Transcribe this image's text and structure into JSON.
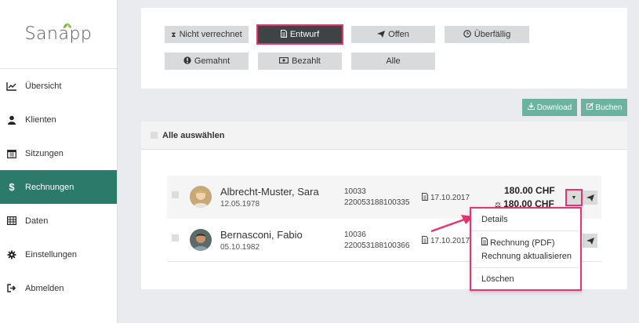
{
  "app": {
    "logo": "Sanapp"
  },
  "sidebar": {
    "items": [
      {
        "label": "Übersicht",
        "icon": "line-chart-icon"
      },
      {
        "label": "Klienten",
        "icon": "user-icon"
      },
      {
        "label": "Sitzungen",
        "icon": "calendar-icon"
      },
      {
        "label": "Rechnungen",
        "icon": "dollar-icon",
        "active": true
      },
      {
        "label": "Daten",
        "icon": "table-icon"
      },
      {
        "label": "Einstellungen",
        "icon": "gear-icon"
      },
      {
        "label": "Abmelden",
        "icon": "sign-out-icon"
      }
    ]
  },
  "filters": {
    "nicht_verrechnet": "Nicht verrechnet",
    "entwurf": "Entwurf",
    "offen": "Offen",
    "ueberfaellig": "Überfällig",
    "gemahnt": "Gemahnt",
    "bezahlt": "Bezahlt",
    "alle": "Alle",
    "active": "Entwurf"
  },
  "actions": {
    "download": "Download",
    "buchen": "Buchen"
  },
  "list": {
    "select_all": "Alle auswählen",
    "rows": [
      {
        "name": "Albrecht-Muster, Sara",
        "dob": "12.05.1978",
        "number": "10033",
        "reference": "220053188100335",
        "date": "17.10.2017",
        "amount": "180.00 CHF",
        "amount_secondary": "180.00 CHF"
      },
      {
        "name": "Bernasconi, Fabio",
        "dob": "05.10.1982",
        "number": "10036",
        "reference": "220053188100366",
        "date": "17.10.2017"
      }
    ]
  },
  "dropdown": {
    "details": "Details",
    "rechnung_pdf": "Rechnung (PDF)",
    "rechnung_aktualisieren": "Rechnung aktualisieren",
    "loeschen": "Löschen"
  },
  "colors": {
    "accent": "#2c7a6a",
    "highlight": "#e8336c",
    "button": "#6bb39e"
  }
}
